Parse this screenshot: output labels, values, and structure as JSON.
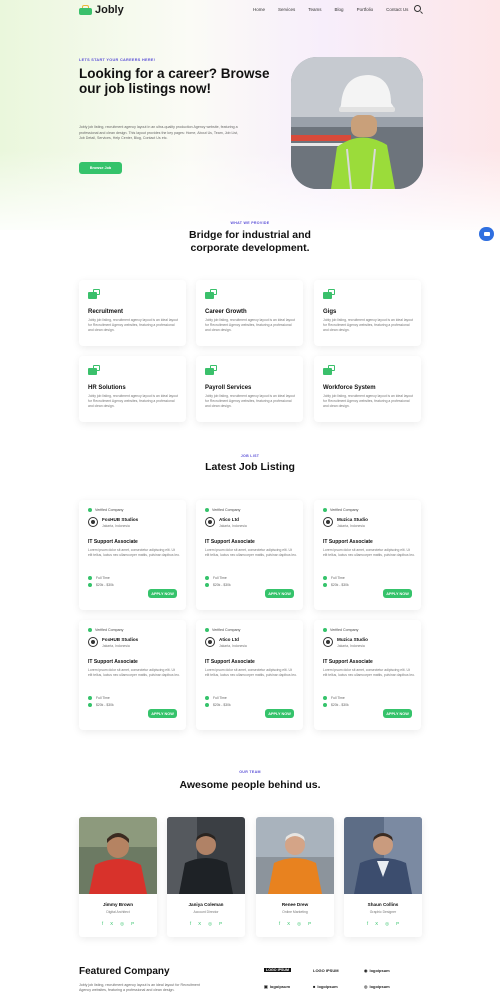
{
  "brand": {
    "name": "Jobly"
  },
  "nav": {
    "items": [
      "Home",
      "Services",
      "Teams",
      "Blog",
      "Portfolio",
      "Contact Us"
    ]
  },
  "hero": {
    "eyebrow": "LETS START YOUR CAREERS HERE!",
    "title": "Looking for a career? Browse our job listings now!",
    "description": "Jobly job listing, recruitment agency layout in an ultra-quality production Agency website, featuring a professional and clean design. This layout provides the key pages: Home, About Us, Team, Job List, Job Detail, Services, Help Center, Blog, Contact Us etc.",
    "button": "Browse Job"
  },
  "services": {
    "eyebrow": "WHAT WE PROVIDE",
    "title": "Bridge for industrial and corporate development.",
    "items": [
      {
        "title": "Recruitment",
        "desc": "Jobly job listing, recruitment agency layout is an ideal layout for Recruitment Agency websites, featuring a professional and clean design."
      },
      {
        "title": "Career Growth",
        "desc": "Jobly job listing, recruitment agency layout is an ideal layout for Recruitment Agency websites, featuring a professional and clean design."
      },
      {
        "title": "Gigs",
        "desc": "Jobly job listing, recruitment agency layout is an ideal layout for Recruitment Agency websites, featuring a professional and clean design."
      },
      {
        "title": "HR Solutions",
        "desc": "Jobly job listing, recruitment agency layout is an ideal layout for Recruitment Agency websites, featuring a professional and clean design."
      },
      {
        "title": "Payroll Services",
        "desc": "Jobly job listing, recruitment agency layout is an ideal layout for Recruitment Agency websites, featuring a professional and clean design."
      },
      {
        "title": "Workforce System",
        "desc": "Jobly job listing, recruitment agency layout is an ideal layout for Recruitment Agency websites, featuring a professional and clean design."
      }
    ]
  },
  "jobs": {
    "eyebrow": "JOB LIST",
    "title": "Latest Job Listing",
    "verified_label": "Verified Company",
    "apply_label": "APPLY NOW",
    "items": [
      {
        "company": "FoxHUB Studios",
        "location": "Jakarta, Indonesia",
        "title": "IT Support Associate",
        "desc": "Lorem ipsum dolor sit amet, consectetur adipiscing elit. Ut elit tellus, luctus nec ullamcorper mattis, pulvinar dapibus leo.",
        "type": "Full Time",
        "salary": "$20k - $30k"
      },
      {
        "company": "Atico Ltd",
        "location": "Jakarta, Indonesia",
        "title": "IT Support Associate",
        "desc": "Lorem ipsum dolor sit amet, consectetur adipiscing elit. Ut elit tellus, luctus nec ullamcorper mattis, pulvinar dapibus leo.",
        "type": "Full Time",
        "salary": "$20k - $30k"
      },
      {
        "company": "Muzica Studio",
        "location": "Jakarta, Indonesia",
        "title": "IT Support Associate",
        "desc": "Lorem ipsum dolor sit amet, consectetur adipiscing elit. Ut elit tellus, luctus nec ullamcorper mattis, pulvinar dapibus leo.",
        "type": "Full Time",
        "salary": "$20k - $30k"
      },
      {
        "company": "FoxHUB Studios",
        "location": "Jakarta, Indonesia",
        "title": "IT Support Associate",
        "desc": "Lorem ipsum dolor sit amet, consectetur adipiscing elit. Ut elit tellus, luctus nec ullamcorper mattis, pulvinar dapibus leo.",
        "type": "Full Time",
        "salary": "$20k - $30k"
      },
      {
        "company": "Atico Ltd",
        "location": "Jakarta, Indonesia",
        "title": "IT Support Associate",
        "desc": "Lorem ipsum dolor sit amet, consectetur adipiscing elit. Ut elit tellus, luctus nec ullamcorper mattis, pulvinar dapibus leo.",
        "type": "Full Time",
        "salary": "$20k - $30k"
      },
      {
        "company": "Muzica Studio",
        "location": "Jakarta, Indonesia",
        "title": "IT Support Associate",
        "desc": "Lorem ipsum dolor sit amet, consectetur adipiscing elit. Ut elit tellus, luctus nec ullamcorper mattis, pulvinar dapibus leo.",
        "type": "Full Time",
        "salary": "$20k - $30k"
      }
    ]
  },
  "team": {
    "eyebrow": "OUR TEAM",
    "title": "Awesome people behind us.",
    "members": [
      {
        "name": "Jimmy Brown",
        "role": "Digital Architect"
      },
      {
        "name": "Janiya Coleman",
        "role": "Account Director"
      },
      {
        "name": "Renee Drew",
        "role": "Online Marketing"
      },
      {
        "name": "Shaun Collins",
        "role": "Graphic Designer"
      }
    ],
    "social_icons": [
      "f",
      "X",
      "◎",
      "P"
    ]
  },
  "featured": {
    "title": "Featured Company",
    "desc": "Jobly job listing, recruitment agency layout is an ideal layout for Recruitment Agency websites, featuring a professional and clean design.",
    "logos": [
      "LOGO IPSUM",
      "LOGO IPSUM",
      "logoipsum",
      "logoipsum",
      "logoipsum",
      "logoipsum"
    ]
  },
  "colors": {
    "accent": "#35c36b",
    "eyebrow": "#5a4fd6",
    "chat": "#2f6fe0"
  }
}
